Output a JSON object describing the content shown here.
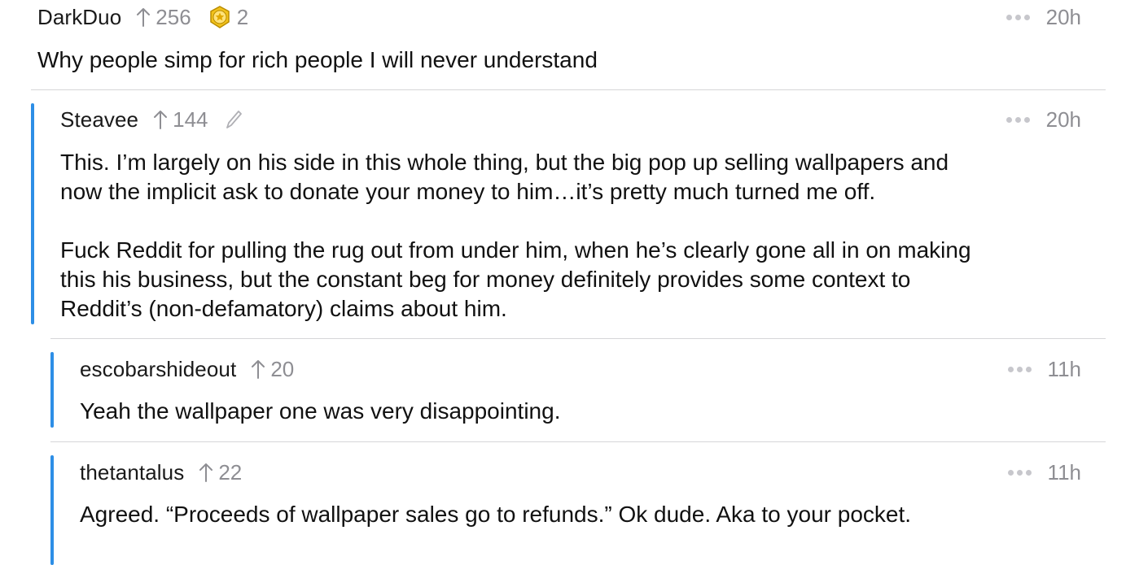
{
  "comments": [
    {
      "author": "DarkDuo",
      "score": "256",
      "award_count": "2",
      "time": "20h",
      "text": "Why people simp for rich people I will never understand"
    },
    {
      "author": "Steavee",
      "score": "144",
      "edited": true,
      "time": "20h",
      "text": "This. I’m largely on his side in this whole thing, but the big pop up selling wallpapers and\nnow the implicit ask to donate your money to him…it’s pretty much turned me off.\n\nFuck Reddit for pulling the rug out from under him, when he’s clearly gone all in on making\nthis his business, but the constant beg for money definitely provides some context to\nReddit’s (non-defamatory) claims about him."
    },
    {
      "author": "escobarshideout",
      "score": "20",
      "time": "11h",
      "text": "Yeah the wallpaper one was very disappointing."
    },
    {
      "author": "thetantalus",
      "score": "22",
      "time": "11h",
      "text": "Agreed. “Proceeds of wallpaper sales go to refunds.” Ok dude. Aka to your pocket."
    }
  ],
  "colors": {
    "thread_line": "#2d8ee6",
    "meta_gray": "#8e8e93",
    "award_gold": "#f2c21b"
  },
  "icons": {
    "upvote": "arrow-up-icon",
    "award": "award-medal-icon",
    "edited": "pencil-icon",
    "more": "ellipsis-icon"
  }
}
